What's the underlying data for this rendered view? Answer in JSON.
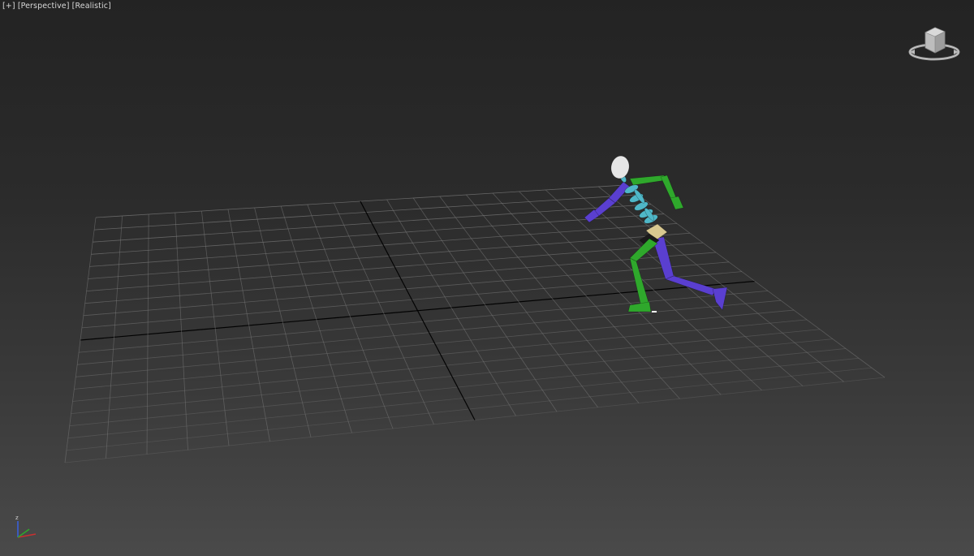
{
  "viewport": {
    "label_plus": "[+]",
    "label_view": "[Perspective]",
    "label_shading": "[Realistic]"
  },
  "navigation": {
    "viewcube_icon": "viewcube-icon",
    "axis_tripod_icon": "axis-tripod-icon",
    "axis_z_label": "z"
  },
  "colors": {
    "grid_line": "#7a7a7a",
    "grid_axis": "#000000",
    "biped_left": "#5a3fd0",
    "biped_right": "#2fa82c",
    "biped_spine": "#4fb7c8",
    "biped_head": "#e6e6e6",
    "biped_pelvis": "#d8c890"
  }
}
